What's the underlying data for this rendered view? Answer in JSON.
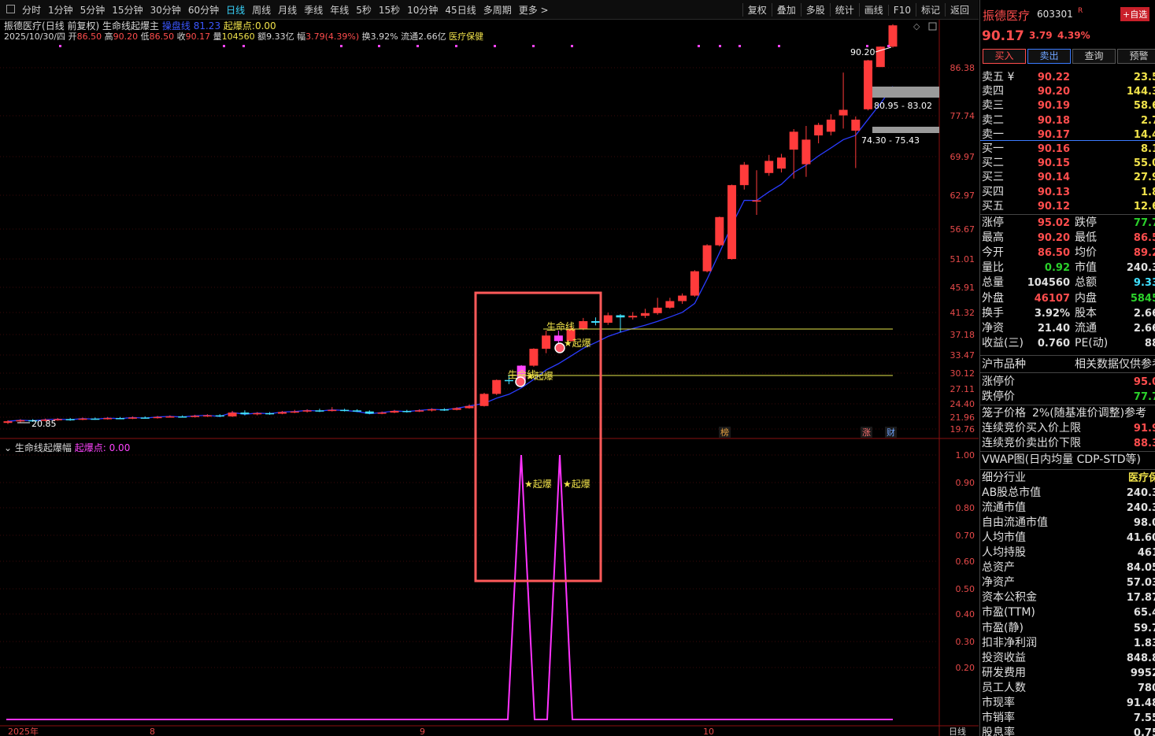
{
  "toolbar": {
    "periods": [
      "分时",
      "1分钟",
      "5分钟",
      "15分钟",
      "30分钟",
      "60分钟",
      "日线",
      "周线",
      "月线",
      "季线",
      "年线",
      "5秒",
      "15秒",
      "10分钟",
      "45日线",
      "多周期",
      "更多 >"
    ],
    "active_period": "日线",
    "tools": [
      "复权",
      "叠加",
      "多股",
      "统计",
      "画线",
      "F10",
      "标记",
      "返回"
    ]
  },
  "info": {
    "stock": "振德医疗",
    "mode": "(日线 前复权)",
    "indicator": "生命线起爆主",
    "lifeline_label": "操盘线",
    "lifeline_value": "81.23",
    "burst_label": "起爆点:",
    "burst_value": "0.00",
    "date": "2025/10/30/四",
    "open_label": "开",
    "open": "86.50",
    "high_label": "高",
    "high": "90.20",
    "low_label": "低",
    "low": "86.50",
    "close_label": "收",
    "close": "90.17",
    "vol_label": "量",
    "vol": "104560",
    "amt_label": "额",
    "amt": "9.33亿",
    "amp_label": "幅",
    "amp": "3.79(4.39%)",
    "turnover_label": "换",
    "turnover": "3.92%",
    "float_label": "流通",
    "float": "2.66亿",
    "sector": "医疗保健"
  },
  "sub": {
    "title": "生命线起爆幅",
    "burst_label": "起爆点:",
    "burst_value": "0.00"
  },
  "chart_data": {
    "type": "candlestick",
    "main_axis": [
      "86.38",
      "77.74",
      "69.97",
      "62.97",
      "56.67",
      "51.01",
      "45.91",
      "41.32",
      "37.18",
      "33.47",
      "30.12",
      "27.11",
      "24.40",
      "21.96",
      "19.76"
    ],
    "sub_axis": [
      "1.00",
      "0.90",
      "0.80",
      "0.70",
      "0.60",
      "0.50",
      "0.40",
      "0.30",
      "0.20"
    ],
    "date_labels": [
      "2025年",
      "8",
      "9",
      "10",
      "日线"
    ],
    "annotations": {
      "low_price": "20.85",
      "high_price": "90.20",
      "zone_upper": "80.95 - 83.02",
      "zone_lower": "74.30 - 75.43",
      "lifeline_label": "生命线",
      "burst_label": "★起爆",
      "badges": [
        "榜",
        "涨",
        "财"
      ]
    },
    "candles": [
      {
        "o": 20.9,
        "c": 21.2,
        "h": 21.4,
        "l": 20.7
      },
      {
        "o": 21.2,
        "c": 21.4,
        "h": 21.6,
        "l": 21.0
      },
      {
        "o": 21.4,
        "c": 21.3,
        "h": 21.6,
        "l": 21.1
      },
      {
        "o": 21.3,
        "c": 21.5,
        "h": 21.7,
        "l": 21.2
      },
      {
        "o": 21.5,
        "c": 21.6,
        "h": 21.8,
        "l": 21.3
      },
      {
        "o": 21.6,
        "c": 21.5,
        "h": 21.8,
        "l": 21.3
      },
      {
        "o": 21.5,
        "c": 21.7,
        "h": 21.9,
        "l": 21.4
      },
      {
        "o": 21.7,
        "c": 21.6,
        "h": 21.9,
        "l": 21.5
      },
      {
        "o": 21.6,
        "c": 21.8,
        "h": 22.0,
        "l": 21.5
      },
      {
        "o": 21.8,
        "c": 21.7,
        "h": 22.0,
        "l": 21.6
      },
      {
        "o": 21.7,
        "c": 21.9,
        "h": 22.1,
        "l": 21.6
      },
      {
        "o": 21.9,
        "c": 21.8,
        "h": 22.1,
        "l": 21.7
      },
      {
        "o": 21.8,
        "c": 22.0,
        "h": 22.2,
        "l": 21.7
      },
      {
        "o": 22.0,
        "c": 22.1,
        "h": 22.3,
        "l": 21.9
      },
      {
        "o": 22.1,
        "c": 22.0,
        "h": 22.3,
        "l": 21.9
      },
      {
        "o": 22.0,
        "c": 22.2,
        "h": 22.4,
        "l": 21.9
      },
      {
        "o": 22.2,
        "c": 22.3,
        "h": 22.5,
        "l": 22.0
      },
      {
        "o": 22.3,
        "c": 22.1,
        "h": 22.5,
        "l": 22.0
      },
      {
        "o": 22.1,
        "c": 22.8,
        "h": 23.1,
        "l": 22.0
      },
      {
        "o": 22.8,
        "c": 22.5,
        "h": 23.2,
        "l": 22.3
      },
      {
        "o": 22.5,
        "c": 22.7,
        "h": 22.9,
        "l": 22.3
      },
      {
        "o": 22.7,
        "c": 22.6,
        "h": 22.9,
        "l": 22.4
      },
      {
        "o": 22.6,
        "c": 22.9,
        "h": 23.1,
        "l": 22.5
      },
      {
        "o": 22.9,
        "c": 23.0,
        "h": 23.3,
        "l": 22.7
      },
      {
        "o": 23.0,
        "c": 23.2,
        "h": 23.4,
        "l": 22.8
      },
      {
        "o": 23.2,
        "c": 23.1,
        "h": 23.5,
        "l": 22.9
      },
      {
        "o": 23.1,
        "c": 23.3,
        "h": 23.8,
        "l": 23.0
      },
      {
        "o": 23.3,
        "c": 23.2,
        "h": 23.5,
        "l": 23.0
      },
      {
        "o": 23.2,
        "c": 23.0,
        "h": 23.4,
        "l": 22.9
      },
      {
        "o": 23.0,
        "c": 22.6,
        "h": 23.2,
        "l": 22.5
      },
      {
        "o": 22.6,
        "c": 22.8,
        "h": 23.0,
        "l": 22.5
      },
      {
        "o": 22.8,
        "c": 23.1,
        "h": 23.3,
        "l": 22.7
      },
      {
        "o": 23.1,
        "c": 23.0,
        "h": 23.3,
        "l": 22.8
      },
      {
        "o": 23.0,
        "c": 23.2,
        "h": 23.4,
        "l": 22.9
      },
      {
        "o": 23.2,
        "c": 23.4,
        "h": 23.6,
        "l": 23.0
      },
      {
        "o": 23.4,
        "c": 23.3,
        "h": 23.6,
        "l": 23.1
      },
      {
        "o": 23.3,
        "c": 23.6,
        "h": 23.8,
        "l": 23.2
      },
      {
        "o": 23.6,
        "c": 24.0,
        "h": 24.3,
        "l": 23.5
      },
      {
        "o": 24.0,
        "c": 26.2,
        "h": 26.4,
        "l": 23.9
      },
      {
        "o": 26.2,
        "c": 28.8,
        "h": 28.9,
        "l": 26.0
      },
      {
        "o": 28.8,
        "c": 28.6,
        "h": 29.8,
        "l": 28.0
      },
      {
        "o": 28.6,
        "c": 31.5,
        "h": 31.6,
        "l": 28.4
      },
      {
        "o": 31.5,
        "c": 34.6,
        "h": 34.7,
        "l": 31.3
      },
      {
        "o": 34.6,
        "c": 37.0,
        "h": 37.9,
        "l": 33.8
      },
      {
        "o": 37.0,
        "c": 36.0,
        "h": 37.9,
        "l": 35.4
      },
      {
        "o": 36.0,
        "c": 38.3,
        "h": 38.7,
        "l": 35.9
      },
      {
        "o": 38.3,
        "c": 39.7,
        "h": 40.3,
        "l": 38.0
      },
      {
        "o": 39.7,
        "c": 39.4,
        "h": 40.4,
        "l": 38.9
      },
      {
        "o": 39.4,
        "c": 40.8,
        "h": 41.3,
        "l": 39.0
      },
      {
        "o": 40.8,
        "c": 40.4,
        "h": 41.0,
        "l": 37.6
      },
      {
        "o": 40.4,
        "c": 40.7,
        "h": 41.4,
        "l": 40.0
      },
      {
        "o": 40.7,
        "c": 41.2,
        "h": 42.0,
        "l": 40.3
      },
      {
        "o": 41.2,
        "c": 42.2,
        "h": 44.0,
        "l": 40.9
      },
      {
        "o": 42.2,
        "c": 43.4,
        "h": 44.0,
        "l": 42.0
      },
      {
        "o": 43.4,
        "c": 44.4,
        "h": 44.8,
        "l": 42.9
      },
      {
        "o": 44.4,
        "c": 48.8,
        "h": 49.0,
        "l": 44.2
      },
      {
        "o": 48.8,
        "c": 53.6,
        "h": 53.8,
        "l": 48.6
      },
      {
        "o": 53.6,
        "c": 58.9,
        "h": 59.0,
        "l": 53.4
      },
      {
        "o": 51.0,
        "c": 64.8,
        "h": 64.9,
        "l": 50.9
      },
      {
        "o": 64.8,
        "c": 68.5,
        "h": 69.0,
        "l": 64.0
      },
      {
        "o": 62.0,
        "c": 62.0,
        "h": 67.5,
        "l": 59.3
      },
      {
        "o": 67.0,
        "c": 69.2,
        "h": 70.3,
        "l": 66.5
      },
      {
        "o": 67.8,
        "c": 69.8,
        "h": 70.5,
        "l": 67.1
      },
      {
        "o": 71.3,
        "c": 74.7,
        "h": 75.2,
        "l": 66.0
      },
      {
        "o": 68.6,
        "c": 73.2,
        "h": 75.8,
        "l": 66.3
      },
      {
        "o": 74.0,
        "c": 76.0,
        "h": 76.4,
        "l": 72.5
      },
      {
        "o": 74.7,
        "c": 77.0,
        "h": 78.0,
        "l": 74.0
      },
      {
        "o": 77.8,
        "c": 78.8,
        "h": 85.5,
        "l": 75.3
      },
      {
        "o": 74.9,
        "c": 77.0,
        "h": 77.6,
        "l": 67.9
      },
      {
        "o": 78.9,
        "c": 87.7,
        "h": 87.8,
        "l": 78.7
      },
      {
        "o": 86.5,
        "c": 90.17,
        "h": 90.2,
        "l": 86.5
      },
      {
        "o": 90.17,
        "c": 94.0,
        "h": 94.2,
        "l": 90.0
      }
    ]
  },
  "panel": {
    "name": "振德医疗",
    "code": "603301",
    "r_mark": "R",
    "add_label": "+自选",
    "price": "90.17",
    "change": "3.79",
    "pct": "4.39%",
    "buttons": [
      "买入",
      "卖出",
      "查询",
      "预警"
    ],
    "asks": [
      {
        "label": "卖五 ¥",
        "price": "90.22",
        "vol": "23.5"
      },
      {
        "label": "卖四",
        "price": "90.20",
        "vol": "144.3"
      },
      {
        "label": "卖三",
        "price": "90.19",
        "vol": "58.6"
      },
      {
        "label": "卖二",
        "price": "90.18",
        "vol": "2.7"
      },
      {
        "label": "卖一",
        "price": "90.17",
        "vol": "14.4"
      }
    ],
    "bids": [
      {
        "label": "买一",
        "price": "90.16",
        "vol": "8.1"
      },
      {
        "label": "买二",
        "price": "90.15",
        "vol": "55.0"
      },
      {
        "label": "买三",
        "price": "90.14",
        "vol": "27.9"
      },
      {
        "label": "买四",
        "price": "90.13",
        "vol": "1.8"
      },
      {
        "label": "买五",
        "price": "90.12",
        "vol": "12.6"
      }
    ],
    "stats": [
      {
        "l": "涨停",
        "v": "95.02",
        "vc": "#ff4d4d",
        "l2": "跌停",
        "v2": "77.7",
        "v2c": "#2bd12b"
      },
      {
        "l": "最高",
        "v": "90.20",
        "vc": "#ff4d4d",
        "l2": "最低",
        "v2": "86.5",
        "v2c": "#ff4d4d"
      },
      {
        "l": "今开",
        "v": "86.50",
        "vc": "#ff4d4d",
        "l2": "均价",
        "v2": "89.2",
        "v2c": "#ff4d4d"
      },
      {
        "l": "量比",
        "v": "0.92",
        "vc": "#2bd12b",
        "l2": "市值",
        "v2": "240.3",
        "v2c": "#e0e0e0"
      },
      {
        "l": "总量",
        "v": "104560",
        "vc": "#e0e0e0",
        "l2": "总额",
        "v2": "9.33",
        "v2c": "#40e0ff"
      },
      {
        "l": "外盘",
        "v": "46107",
        "vc": "#ff4d4d",
        "l2": "内盘",
        "v2": "5845",
        "v2c": "#2bd12b"
      },
      {
        "l": "换手",
        "v": "3.92%",
        "vc": "#e0e0e0",
        "l2": "股本",
        "v2": "2.66",
        "v2c": "#e0e0e0"
      },
      {
        "l": "净资",
        "v": "21.40",
        "vc": "#e0e0e0",
        "l2": "流通",
        "v2": "2.66",
        "v2c": "#e0e0e0"
      },
      {
        "l": "收益(三)",
        "v": "0.760",
        "vc": "#e0e0e0",
        "l2": "PE(动)",
        "v2": "88",
        "v2c": "#e0e0e0"
      }
    ],
    "market_label": "沪市品种",
    "market_note": "相关数据仅供参考",
    "limits": [
      {
        "l": "涨停价",
        "v": "95.0",
        "vc": "#ff4d4d"
      },
      {
        "l": "跌停价",
        "v": "77.7",
        "vc": "#2bd12b"
      }
    ],
    "cage_label": "笼子价格",
    "cage_value": "2%(随基准价调整)参考",
    "auctions": [
      {
        "l": "连续竞价买入价上限",
        "v": "91.9",
        "vc": "#ff4d4d"
      },
      {
        "l": "连续竞价卖出价下限",
        "v": "88.3",
        "vc": "#ff4d4d"
      }
    ],
    "vwap_label": "VWAP图(日内均量 CDP-STD等)",
    "fundamentals": [
      {
        "l": "细分行业",
        "v": "医疗保",
        "vc": "#f0e24a"
      },
      {
        "l": "AB股总市值",
        "v": "240.3",
        "vc": "#e0e0e0"
      },
      {
        "l": "流通市值",
        "v": "240.3",
        "vc": "#e0e0e0"
      },
      {
        "l": "自由流通市值",
        "v": "98.0",
        "vc": "#e0e0e0"
      },
      {
        "l": "人均市值",
        "v": "41.60",
        "vc": "#e0e0e0"
      },
      {
        "l": "人均持股",
        "v": "461",
        "vc": "#e0e0e0"
      },
      {
        "l": "总资产",
        "v": "84.05",
        "vc": "#e0e0e0"
      },
      {
        "l": "净资产",
        "v": "57.03",
        "vc": "#e0e0e0"
      },
      {
        "l": "资本公积金",
        "v": "17.87",
        "vc": "#e0e0e0"
      },
      {
        "l": "市盈(TTM)",
        "v": "65.4",
        "vc": "#e0e0e0"
      },
      {
        "l": "市盈(静)",
        "v": "59.7",
        "vc": "#e0e0e0"
      },
      {
        "l": "扣非净利润",
        "v": "1.83",
        "vc": "#e0e0e0"
      },
      {
        "l": "投资收益",
        "v": "848.8",
        "vc": "#e0e0e0"
      },
      {
        "l": "研发费用",
        "v": "9952",
        "vc": "#e0e0e0"
      },
      {
        "l": "员工人数",
        "v": "780",
        "vc": "#e0e0e0"
      },
      {
        "l": "市现率",
        "v": "91.48",
        "vc": "#e0e0e0"
      },
      {
        "l": "市销率",
        "v": "7.55",
        "vc": "#e0e0e0"
      },
      {
        "l": "股息率",
        "v": "0.75",
        "vc": "#e0e0e0"
      }
    ]
  }
}
